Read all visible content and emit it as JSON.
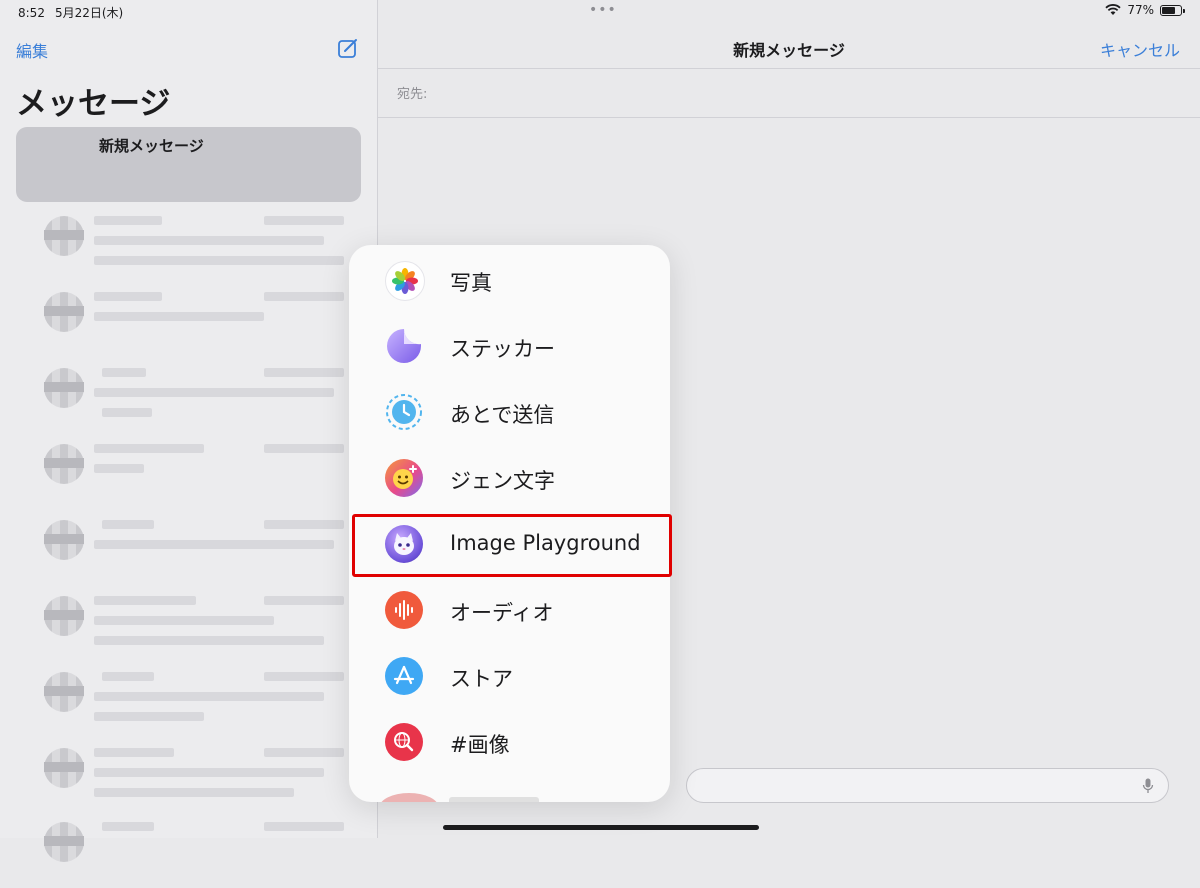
{
  "status_bar": {
    "time": "8:52",
    "date": "5月22日(木)",
    "battery_text": "77%",
    "battery_level": 0.77
  },
  "sidebar": {
    "edit_label": "編集",
    "title": "メッセージ",
    "new_message_card_label": "新規メッセージ"
  },
  "main": {
    "title": "新規メッセージ",
    "cancel_label": "キャンセル",
    "to_label": "宛先:"
  },
  "menu": {
    "items": [
      {
        "label": "写真",
        "icon": "photos-icon"
      },
      {
        "label": "ステッカー",
        "icon": "stickers-icon"
      },
      {
        "label": "あとで送信",
        "icon": "send-later-icon"
      },
      {
        "label": "ジェン文字",
        "icon": "genmoji-icon"
      },
      {
        "label": "Image Playground",
        "icon": "image-playground-icon"
      },
      {
        "label": "オーディオ",
        "icon": "audio-icon"
      },
      {
        "label": "ストア",
        "icon": "app-store-icon"
      },
      {
        "label": "#画像",
        "icon": "images-search-icon"
      }
    ]
  },
  "colors": {
    "accent": "#3b7fd8",
    "highlight": "#e00000"
  }
}
